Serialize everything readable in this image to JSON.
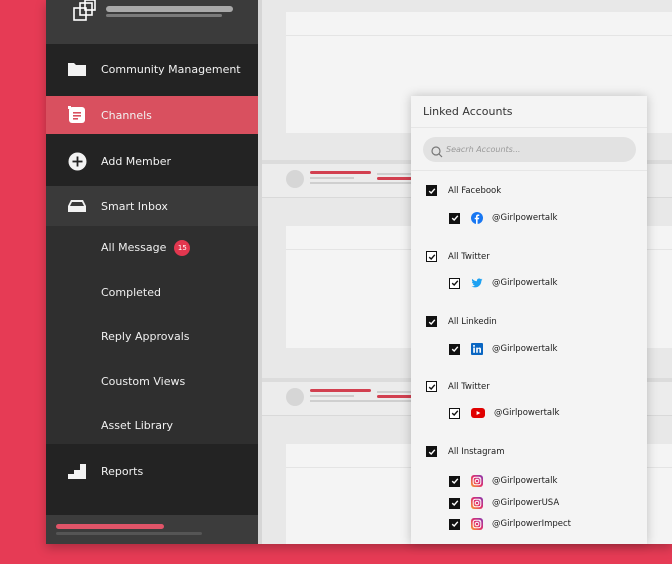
{
  "colors": {
    "brand_red": "#e63b55",
    "active_item": "#d9505f",
    "badge": "#e2374f",
    "facebook": "#1877f2",
    "twitter": "#1da1f2",
    "linkedin": "#0a66c2",
    "youtube": "#e00000"
  },
  "sidebar": {
    "logo_icon": "overlapping-squares-icon",
    "items": [
      {
        "label": "Community Management",
        "icon": "folder-icon"
      },
      {
        "label": "Channels",
        "icon": "channels-icon",
        "active": true
      },
      {
        "label": "Add Member",
        "icon": "plus-circle-icon"
      },
      {
        "label": "Smart Inbox",
        "icon": "inbox-icon"
      }
    ],
    "sub_items": [
      {
        "label": "All Message",
        "badge": "15"
      },
      {
        "label": "Completed"
      },
      {
        "label": "Reply Approvals"
      },
      {
        "label": "Coustom Views"
      },
      {
        "label": "Asset Library"
      }
    ],
    "reports": {
      "label": "Reports",
      "icon": "bar-steps-icon"
    }
  },
  "popup": {
    "title": "Linked Accounts",
    "search_placeholder": "Seacrh Accounts...",
    "search_value": "",
    "groups": [
      {
        "label": "All Facebook",
        "checked": true,
        "style": "filled",
        "accounts": [
          {
            "handle": "@Girlpowertalk",
            "network": "facebook",
            "checked": true,
            "style": "filled"
          }
        ]
      },
      {
        "label": "All Twitter",
        "checked": true,
        "style": "outline",
        "accounts": [
          {
            "handle": "@Girlpowertalk",
            "network": "twitter",
            "checked": true,
            "style": "outline"
          }
        ]
      },
      {
        "label": "All Linkedin",
        "checked": true,
        "style": "filled",
        "accounts": [
          {
            "handle": "@Girlpowertalk",
            "network": "linkedin",
            "checked": true,
            "style": "filled"
          }
        ]
      },
      {
        "label": "All Twitter",
        "checked": true,
        "style": "outline",
        "accounts": [
          {
            "handle": "@Girlpowertalk",
            "network": "youtube",
            "checked": true,
            "style": "outline"
          }
        ]
      },
      {
        "label": "All Instagram",
        "checked": true,
        "style": "filled",
        "accounts": [
          {
            "handle": "@Girlpowertalk",
            "network": "instagram",
            "checked": true,
            "style": "filled"
          },
          {
            "handle": "@GirlpowerUSA",
            "network": "instagram",
            "checked": true,
            "style": "filled"
          },
          {
            "handle": "@GirlpowerImpect",
            "network": "instagram",
            "checked": true,
            "style": "filled"
          }
        ]
      }
    ]
  }
}
